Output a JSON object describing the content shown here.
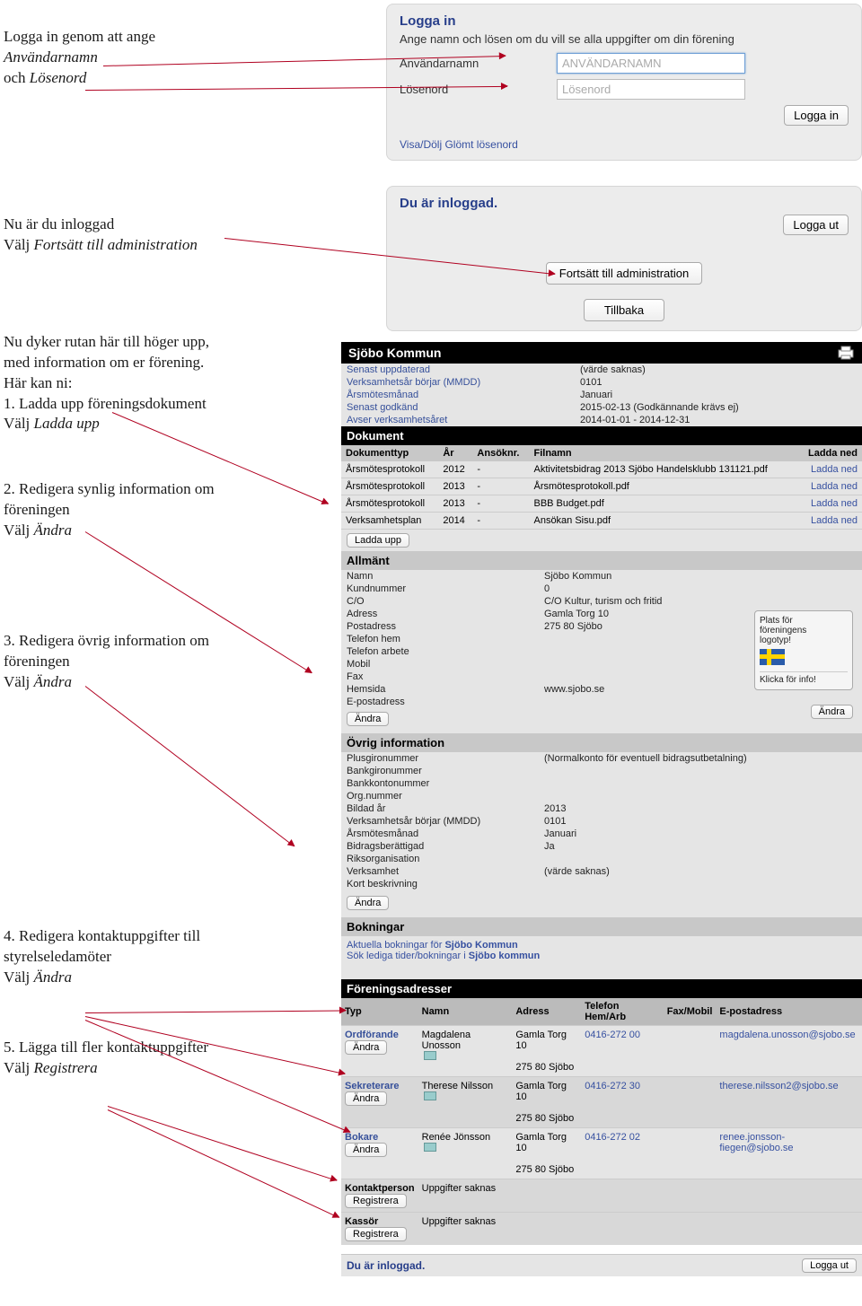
{
  "instructions": {
    "login": {
      "line1": "Logga in genom att ange",
      "user": "Användarnamn",
      "and": "och",
      "pass": "Lösenord"
    },
    "logged": {
      "line1": "Nu är du inloggad",
      "line2_pre": "Välj",
      "line2_em": "Fortsätt till administration"
    },
    "panel3_intro": {
      "l1": "Nu dyker rutan här till höger upp,",
      "l2": "med information om er förening.",
      "l3": "Här kan ni:"
    },
    "step1": {
      "t": "1. Ladda upp föreningsdokument",
      "pre": "Välj",
      "em": "Ladda upp"
    },
    "step2": {
      "t1": "2. Redigera synlig information om",
      "t2": "föreningen",
      "pre": "Välj",
      "em": "Ändra"
    },
    "step3": {
      "t1": "3. Redigera övrig information om",
      "t2": "föreningen",
      "pre": "Välj",
      "em": "Ändra"
    },
    "step4": {
      "t1": "4. Redigera kontaktuppgifter till",
      "t2": "styrelseledamöter",
      "pre": "Välj",
      "em": "Ändra"
    },
    "step5": {
      "t": "5. Lägga till fler kontaktuppgifter",
      "pre": "Välj",
      "em": "Registrera"
    }
  },
  "login_box": {
    "heading": "Logga in",
    "sub": "Ange namn och lösen om du vill se alla uppgifter om din förening",
    "user_label": "Användarnamn",
    "user_placeholder": "ANVÄNDARNAMN",
    "pass_label": "Lösenord",
    "pass_placeholder": "Lösenord",
    "btn": "Logga in",
    "forgot": "Visa/Dölj Glömt lösenord"
  },
  "logged_box": {
    "heading": "Du är inloggad.",
    "logout": "Logga ut",
    "cont": "Fortsätt till administration",
    "back": "Tillbaka"
  },
  "admin": {
    "title": "Sjöbo Kommun",
    "meta": [
      {
        "k": "Senast uppdaterad",
        "v": "(värde saknas)"
      },
      {
        "k": "Verksamhetsår börjar (MMDD)",
        "v": "0101"
      },
      {
        "k": "Årsmötesmånad",
        "v": "Januari"
      },
      {
        "k": "Senast godkänd",
        "v": "2015-02-13 (Godkännande krävs ej)"
      },
      {
        "k": "Avser verksamhetsåret",
        "v": "2014-01-01 - 2014-12-31"
      }
    ],
    "dokument": {
      "title": "Dokument",
      "head": [
        "Dokumenttyp",
        "År",
        "Ansöknr.",
        "Filnamn",
        "Ladda ned"
      ],
      "rows": [
        {
          "t": "Årsmötesprotokoll",
          "y": "2012",
          "a": "-",
          "f": "Aktivitetsbidrag 2013 Sjöbo Handelsklubb 131121.pdf",
          "d": "Ladda ned"
        },
        {
          "t": "Årsmötesprotokoll",
          "y": "2013",
          "a": "-",
          "f": "Årsmötesprotokoll.pdf",
          "d": "Ladda ned"
        },
        {
          "t": "Årsmötesprotokoll",
          "y": "2013",
          "a": "-",
          "f": "BBB Budget.pdf",
          "d": "Ladda ned"
        },
        {
          "t": "Verksamhetsplan",
          "y": "2014",
          "a": "-",
          "f": "Ansökan Sisu.pdf",
          "d": "Ladda ned"
        }
      ],
      "upload": "Ladda upp"
    },
    "allmant": {
      "title": "Allmänt",
      "rows": [
        {
          "k": "Namn",
          "v": "Sjöbo Kommun"
        },
        {
          "k": "Kundnummer",
          "v": "0"
        },
        {
          "k": "C/O",
          "v": "C/O Kultur, turism och fritid"
        },
        {
          "k": "Adress",
          "v": "Gamla Torg 10"
        },
        {
          "k": "Postadress",
          "v": "275 80  Sjöbo"
        },
        {
          "k": "Telefon hem",
          "v": ""
        },
        {
          "k": "Telefon arbete",
          "v": ""
        },
        {
          "k": "Mobil",
          "v": ""
        },
        {
          "k": "Fax",
          "v": ""
        },
        {
          "k": "Hemsida",
          "v": "www.sjobo.se",
          "link": true
        },
        {
          "k": "E-postadress",
          "v": ""
        }
      ],
      "infobox": {
        "l1": "Plats för",
        "l2": "föreningens",
        "l3": "logotyp!",
        "info": "Klicka för info!"
      },
      "btn1": "Ändra",
      "btn2": "Ändra"
    },
    "ovrig": {
      "title": "Övrig information",
      "rows": [
        {
          "k": "Plusgironummer",
          "v": "(Normalkonto för eventuell bidragsutbetalning)"
        },
        {
          "k": "Bankgironummer",
          "v": ""
        },
        {
          "k": "Bankkontonummer",
          "v": ""
        },
        {
          "k": "Org.nummer",
          "v": ""
        },
        {
          "k": "Bildad år",
          "v": "2013"
        },
        {
          "k": "Verksamhetsår börjar (MMDD)",
          "v": "0101"
        },
        {
          "k": "Årsmötesmånad",
          "v": "Januari"
        },
        {
          "k": "Bidragsberättigad",
          "v": "Ja"
        },
        {
          "k": "Riksorganisation",
          "v": ""
        },
        {
          "k": "Verksamhet",
          "v": "(värde saknas)"
        },
        {
          "k": "Kort beskrivning",
          "v": ""
        }
      ],
      "btn": "Ändra"
    },
    "bokningar": {
      "title": "Bokningar",
      "l1_pre": "Aktuella bokningar för ",
      "l1_b": "Sjöbo Kommun",
      "l2_pre": "Sök lediga tider/bokningar i ",
      "l2_b": "Sjöbo kommun"
    },
    "adresser": {
      "title": "Föreningsadresser",
      "head": [
        "Typ",
        "Namn",
        "Adress",
        "Telefon Hem/Arb",
        "Fax/Mobil",
        "E-postadress"
      ],
      "rows": [
        {
          "role": "Ordförande",
          "name": "Magdalena Unosson",
          "addr1": "Gamla Torg 10",
          "addr2": "275 80 Sjöbo",
          "tel": "0416-272 00",
          "email": "magdalena.unosson@sjobo.se",
          "btn": "Ändra"
        },
        {
          "role": "Sekreterare",
          "name": "Therese Nilsson",
          "addr1": "Gamla Torg 10",
          "addr2": "275 80 Sjöbo",
          "tel": "0416-272 30",
          "email": "therese.nilsson2@sjobo.se",
          "btn": "Ändra"
        },
        {
          "role": "Bokare",
          "name": "Renée Jönsson",
          "addr1": "Gamla Torg 10",
          "addr2": "275 80 Sjöbo",
          "tel": "0416-272 02",
          "email": "renee.jonsson-fiegen@sjobo.se",
          "btn": "Ändra"
        },
        {
          "role": "Kontaktperson",
          "missing": "Uppgifter saknas",
          "btn": "Registrera"
        },
        {
          "role": "Kassör",
          "missing": "Uppgifter saknas",
          "btn": "Registrera"
        }
      ]
    },
    "footer": {
      "text": "Du är inloggad.",
      "logout": "Logga ut"
    }
  }
}
